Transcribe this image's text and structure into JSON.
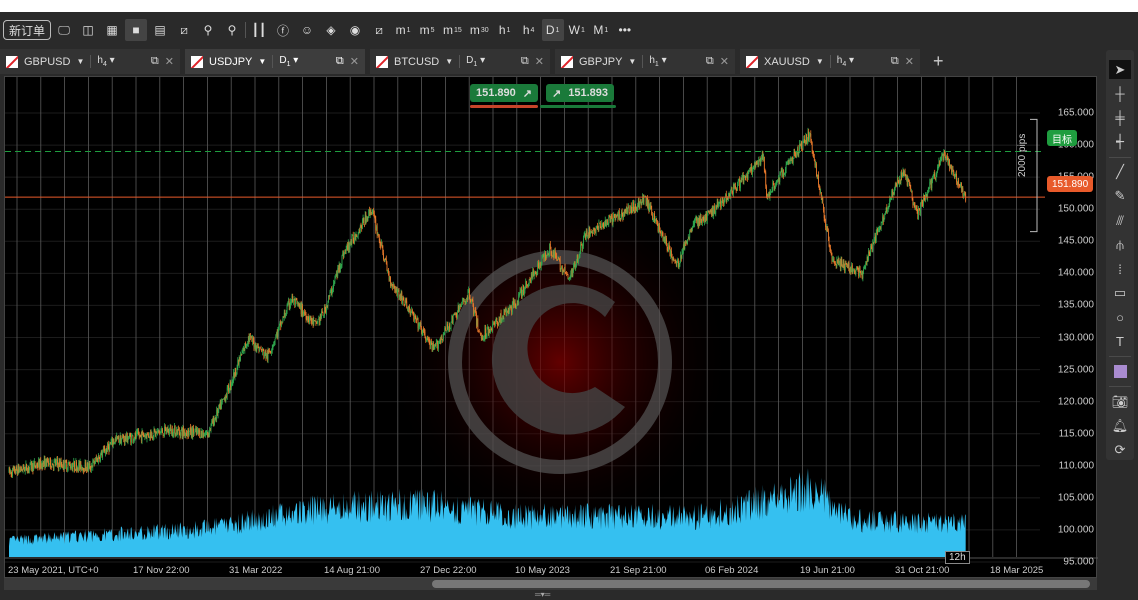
{
  "toolbar": {
    "new_order": "新订单",
    "timeframes": [
      {
        "l": "m",
        "s": "1"
      },
      {
        "l": "m",
        "s": "5"
      },
      {
        "l": "m",
        "s": "15"
      },
      {
        "l": "m",
        "s": "30"
      },
      {
        "l": "h",
        "s": "1"
      },
      {
        "l": "h",
        "s": "4"
      },
      {
        "l": "D",
        "s": "1",
        "selected": true
      },
      {
        "l": "W",
        "s": "1"
      },
      {
        "l": "M",
        "s": "1"
      }
    ],
    "more": "•••"
  },
  "tabs": [
    {
      "symbol": "GBPUSD",
      "tf": "h",
      "tfs": "4"
    },
    {
      "symbol": "USDJPY",
      "tf": "D",
      "tfs": "1",
      "active": true
    },
    {
      "symbol": "BTCUSD",
      "tf": "D",
      "tfs": "1"
    },
    {
      "symbol": "GBPJPY",
      "tf": "h",
      "tfs": "1"
    },
    {
      "symbol": "XAUUSD",
      "tf": "h",
      "tfs": "4"
    }
  ],
  "trade": {
    "sell": "151.890",
    "buy": "151.893"
  },
  "chart_data": {
    "type": "candlestick",
    "symbol": "USDJPY",
    "timeframe": "D1",
    "ylim": [
      95,
      165
    ],
    "y_ticks": [
      "165.000",
      "160.000",
      "155.000",
      "150.000",
      "145.000",
      "140.000",
      "135.000",
      "130.000",
      "125.000",
      "120.000",
      "115.000",
      "110.000",
      "105.000",
      "100.000",
      "95.000"
    ],
    "x_ticks": [
      "23 May 2021, UTC+0",
      "17 Nov 22:00",
      "31 Mar 2022",
      "14 Aug 21:00",
      "27 Dec 22:00",
      "10 May 2023",
      "21 Sep 21:00",
      "06 Feb 2024",
      "19 Jun 21:00",
      "31 Oct 21:00",
      "18 Mar 2025"
    ],
    "x_range": [
      "2021-05-23",
      "2025-03-18"
    ],
    "price_path": [
      [
        "2021-05-23",
        109
      ],
      [
        "2021-07-15",
        110.5
      ],
      [
        "2021-09-15",
        109.8
      ],
      [
        "2021-10-20",
        114
      ],
      [
        "2021-11-17",
        114.5
      ],
      [
        "2022-01-05",
        115.5
      ],
      [
        "2022-03-01",
        115
      ],
      [
        "2022-03-31",
        122
      ],
      [
        "2022-04-28",
        130
      ],
      [
        "2022-05-25",
        127
      ],
      [
        "2022-06-28",
        136
      ],
      [
        "2022-08-01",
        132
      ],
      [
        "2022-08-14",
        134
      ],
      [
        "2022-09-10",
        143
      ],
      [
        "2022-10-20",
        150
      ],
      [
        "2022-11-15",
        139
      ],
      [
        "2022-12-20",
        133
      ],
      [
        "2023-01-16",
        128
      ],
      [
        "2023-03-08",
        137
      ],
      [
        "2023-03-24",
        130
      ],
      [
        "2023-05-10",
        135
      ],
      [
        "2023-06-30",
        144
      ],
      [
        "2023-07-28",
        139
      ],
      [
        "2023-08-20",
        146
      ],
      [
        "2023-09-21",
        148
      ],
      [
        "2023-11-13",
        151.5
      ],
      [
        "2023-12-28",
        141
      ],
      [
        "2024-01-20",
        148
      ],
      [
        "2024-02-06",
        148.5
      ],
      [
        "2024-04-29",
        158
      ],
      [
        "2024-05-03",
        152
      ],
      [
        "2024-07-03",
        161.8
      ],
      [
        "2024-08-05",
        142
      ],
      [
        "2024-09-16",
        140
      ],
      [
        "2024-10-20",
        150
      ],
      [
        "2024-10-31",
        153
      ],
      [
        "2024-11-15",
        156
      ],
      [
        "2024-12-03",
        149
      ],
      [
        "2025-01-10",
        158.5
      ],
      [
        "2025-02-10",
        151.9
      ]
    ],
    "volume_levels": [
      [
        "2021-05-23",
        0.2
      ],
      [
        "2022-03-01",
        0.35
      ],
      [
        "2022-08-14",
        0.6
      ],
      [
        "2022-12-27",
        0.65
      ],
      [
        "2023-05-10",
        0.5
      ],
      [
        "2024-02-06",
        0.5
      ],
      [
        "2024-07-10",
        0.85
      ],
      [
        "2024-09-01",
        0.45
      ],
      [
        "2025-02-10",
        0.4
      ]
    ],
    "current_price": "151.890",
    "target_label": "目标",
    "target_price": 159.0,
    "range_label": "2000 pips",
    "countdown": "12h",
    "colors": {
      "up": "#2fa84f",
      "down": "#e8792b",
      "volume": "#35c0f0",
      "price_line": "#e85a2a",
      "target": "#1f9d3f"
    }
  }
}
